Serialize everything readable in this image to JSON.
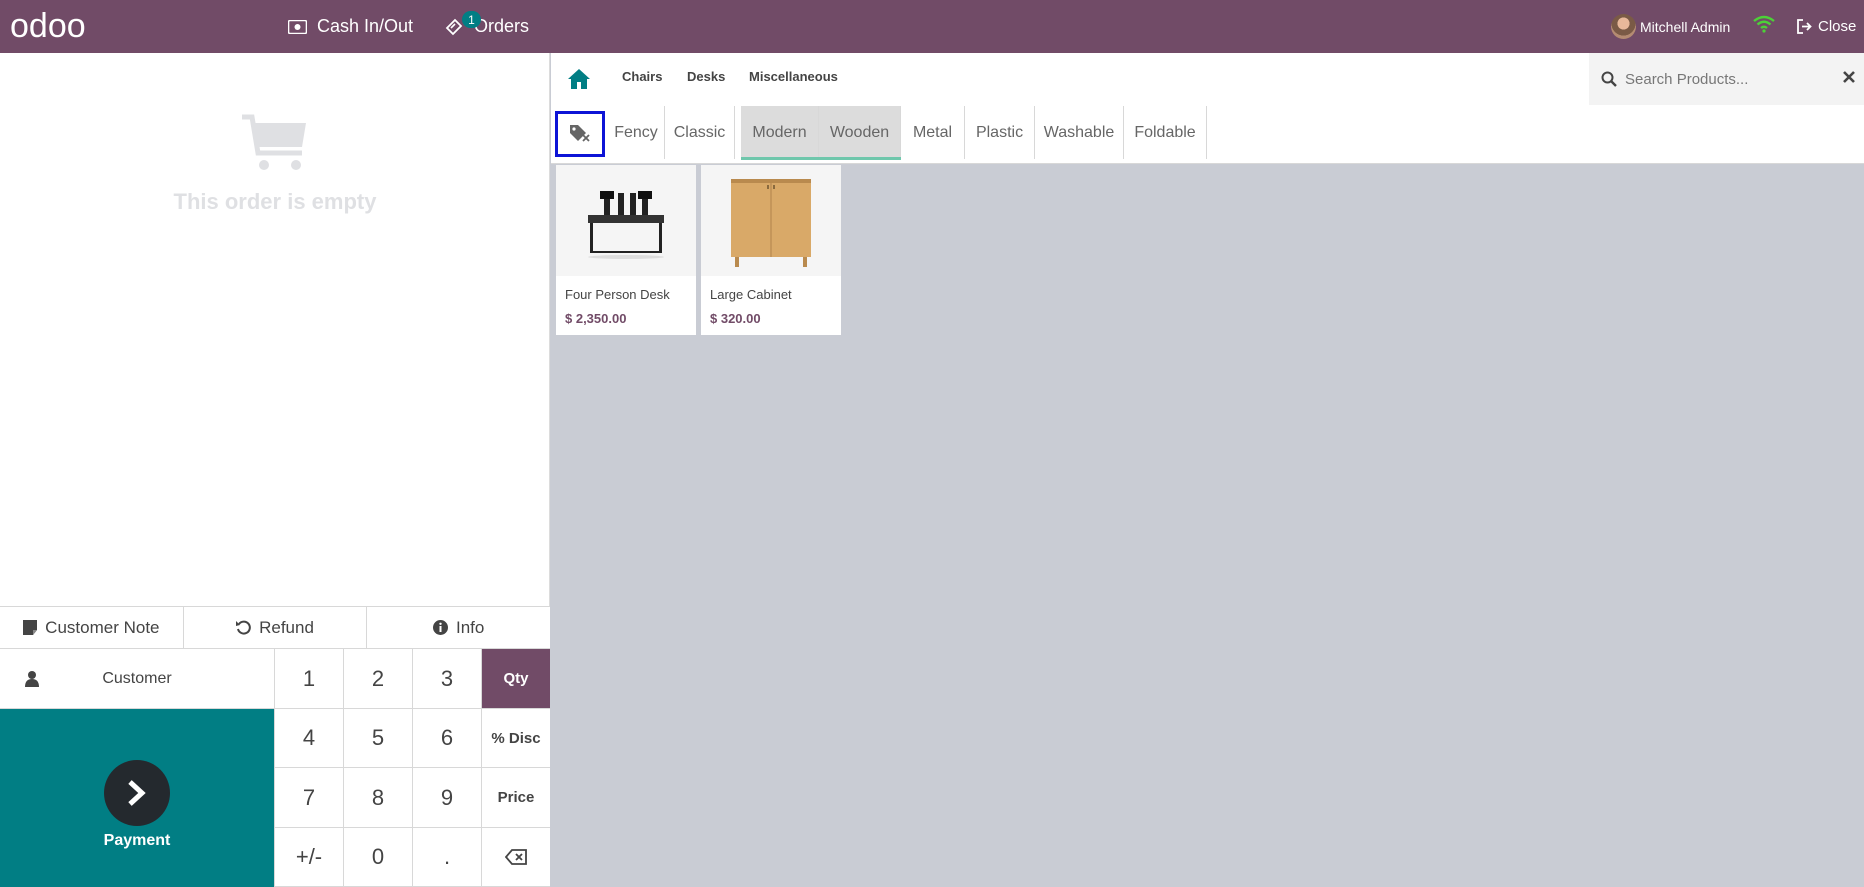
{
  "navbar": {
    "logo_text": "odoo",
    "cash_label": "Cash In/Out",
    "orders_label": "Orders",
    "orders_badge": "1",
    "user_name": "Mitchell Admin",
    "close_label": "Close",
    "bg_color": "#714b67"
  },
  "order": {
    "empty_text": "This order is empty"
  },
  "controls": {
    "note_label": "Customer Note",
    "refund_label": "Refund",
    "info_label": "Info",
    "customer_label": "Customer",
    "payment_label": "Payment"
  },
  "numpad": {
    "keys": [
      "1",
      "2",
      "3",
      "Qty",
      "4",
      "5",
      "6",
      "% Disc",
      "7",
      "8",
      "9",
      "Price",
      "+/-",
      "0",
      ".",
      "⌫"
    ],
    "active_mode": "Qty"
  },
  "categories": {
    "items": [
      "Chairs",
      "Desks",
      "Miscellaneous"
    ]
  },
  "search": {
    "placeholder": "Search Products..."
  },
  "tags": {
    "items": [
      "Fency",
      "Classic",
      "Modern",
      "Wooden",
      "Metal",
      "Plastic",
      "Washable",
      "Foldable"
    ],
    "active": [
      "Modern",
      "Wooden"
    ]
  },
  "products": [
    {
      "name": "Four Person Desk",
      "price": "$ 2,350.00",
      "icon": "desk-image"
    },
    {
      "name": "Large Cabinet",
      "price": "$ 320.00",
      "icon": "cabinet-image"
    }
  ],
  "colors": {
    "brand": "#714b67",
    "teal": "#017e84",
    "highlight": "#0d14d6"
  }
}
